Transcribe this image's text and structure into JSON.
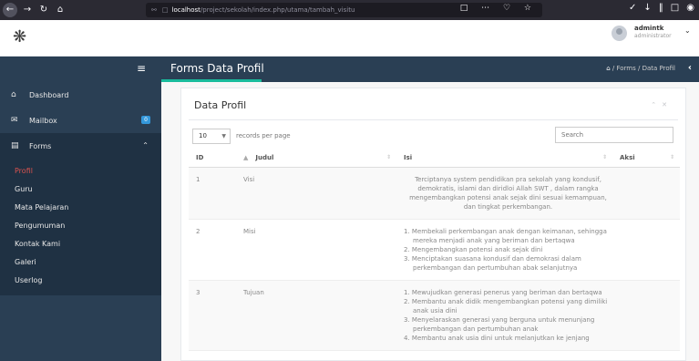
{
  "browser": {
    "url_host": "localhost",
    "url_path": "/project/sekolah/index.php/utama/tambah_visitu"
  },
  "user": {
    "name": "admintk",
    "role": "administrator"
  },
  "sidebar": {
    "items": [
      {
        "label": "Dashboard",
        "icon": "home-icon"
      },
      {
        "label": "Mailbox",
        "icon": "envelope-icon",
        "badge": "0"
      },
      {
        "label": "Forms",
        "icon": "table-icon"
      }
    ],
    "sub_items": [
      "Profil",
      "Guru",
      "Mata Pelajaran",
      "Pengumuman",
      "Kontak Kami",
      "Galeri",
      "Userlog"
    ]
  },
  "header": {
    "title": "Forms Data Profil",
    "breadcrumb_forms": "Forms",
    "breadcrumb_current": "Data Profil",
    "separator": "/"
  },
  "panel": {
    "title": "Data Profil",
    "length_value": "10",
    "length_label": "records per page",
    "search_placeholder": "Search"
  },
  "table": {
    "columns": [
      "ID",
      "Judul",
      "Isi",
      "Aksi"
    ],
    "rows": [
      {
        "id": "1",
        "judul": "Visi",
        "isi": "Terciptanya system pendidikan pra sekolah yang kondusif, demokratis, islami dan diridloi Allah SWT , dalam rangka mengembangkan potensi anak sejak dini sesuai kemampuan, dan tingkat perkembangan."
      },
      {
        "id": "2",
        "judul": "Misi",
        "isi_list": [
          "1. Membekali perkembangan anak dengan keimanan, sehingga mereka menjadi anak yang beriman dan bertaqwa",
          "2. Mengembangkan potensi anak sejak dini",
          "3. Menciptakan suasana kondusif dan demokrasi dalam perkembangan dan pertumbuhan abak selanjutnya"
        ]
      },
      {
        "id": "3",
        "judul": "Tujuan",
        "isi_list": [
          "1. Mewujudkan generasi penerus yang beriman dan bertaqwa",
          "2. Membantu anak didik mengembangkan potensi yang dimiliki anak usia dini",
          "3. Menyelaraskan generasi yang berguna untuk menunjang perkembangan dan pertumbuhan anak",
          "4. Membantu anak usia dini untuk melanjutkan ke jenjang"
        ]
      }
    ]
  }
}
